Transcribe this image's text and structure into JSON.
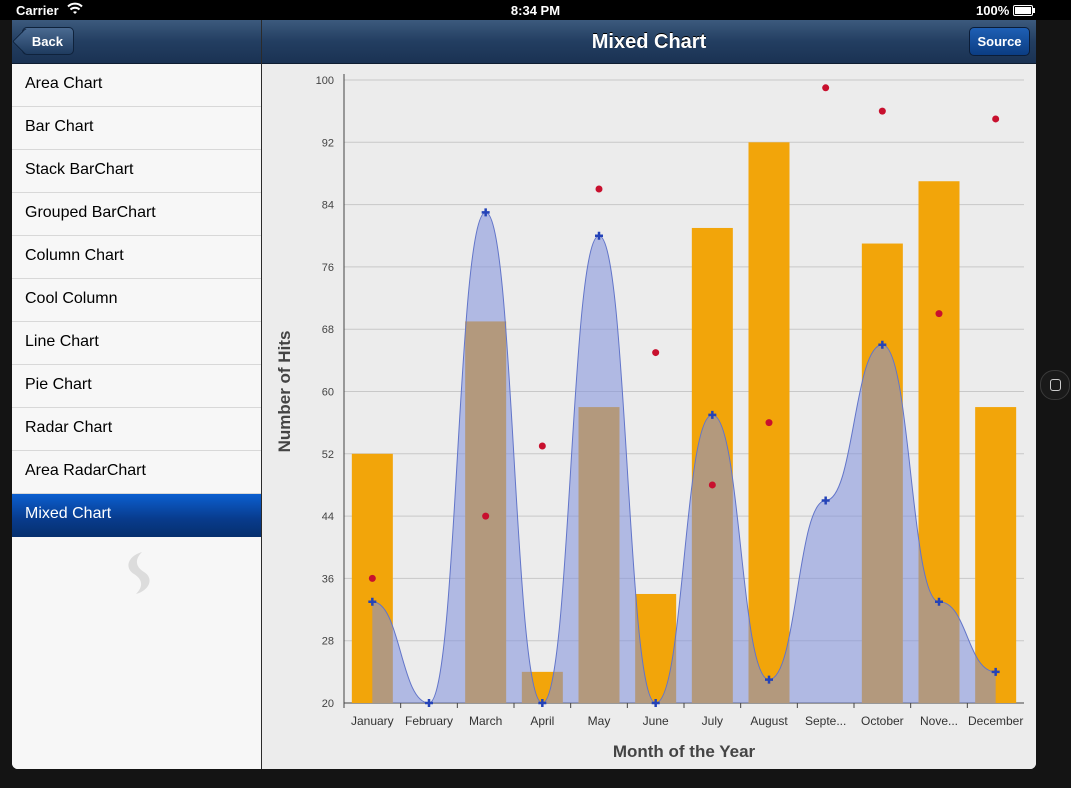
{
  "status_bar": {
    "carrier": "Carrier",
    "time": "8:34 PM",
    "battery": "100%"
  },
  "nav": {
    "back_label": "Back",
    "title": "Mixed Chart",
    "source_label": "Source"
  },
  "sidebar": {
    "items": [
      {
        "label": "Area Chart",
        "selected": false
      },
      {
        "label": "Bar Chart",
        "selected": false
      },
      {
        "label": "Stack BarChart",
        "selected": false
      },
      {
        "label": "Grouped BarChart",
        "selected": false
      },
      {
        "label": "Column Chart",
        "selected": false
      },
      {
        "label": "Cool Column",
        "selected": false
      },
      {
        "label": "Line Chart",
        "selected": false
      },
      {
        "label": "Pie Chart",
        "selected": false
      },
      {
        "label": "Radar Chart",
        "selected": false
      },
      {
        "label": "Area RadarChart",
        "selected": false
      },
      {
        "label": "Mixed Chart",
        "selected": true
      }
    ]
  },
  "chart_data": {
    "type": "bar",
    "categories": [
      "January",
      "February",
      "March",
      "April",
      "May",
      "June",
      "July",
      "August",
      "Septe...",
      "October",
      "Nove...",
      "December"
    ],
    "series": [
      {
        "type": "column",
        "color": "#f2a50a",
        "values": [
          52,
          20,
          69,
          24,
          58,
          34,
          81,
          92,
          20,
          79,
          87,
          58
        ]
      },
      {
        "type": "area",
        "color": "#7f8fdc",
        "values": [
          33,
          20,
          83,
          20,
          80,
          20,
          57,
          23,
          46,
          66,
          33,
          24
        ]
      },
      {
        "type": "scatter",
        "color": "#c8102e",
        "values": [
          36,
          null,
          44,
          53,
          86,
          65,
          48,
          56,
          99,
          96,
          70,
          95
        ]
      }
    ],
    "xlabel": "Month of the Year",
    "ylabel": "Number of Hits",
    "ylim": [
      20,
      100
    ],
    "yticks": [
      20,
      28,
      36,
      44,
      52,
      60,
      68,
      76,
      84,
      92,
      100
    ],
    "grid": true
  }
}
